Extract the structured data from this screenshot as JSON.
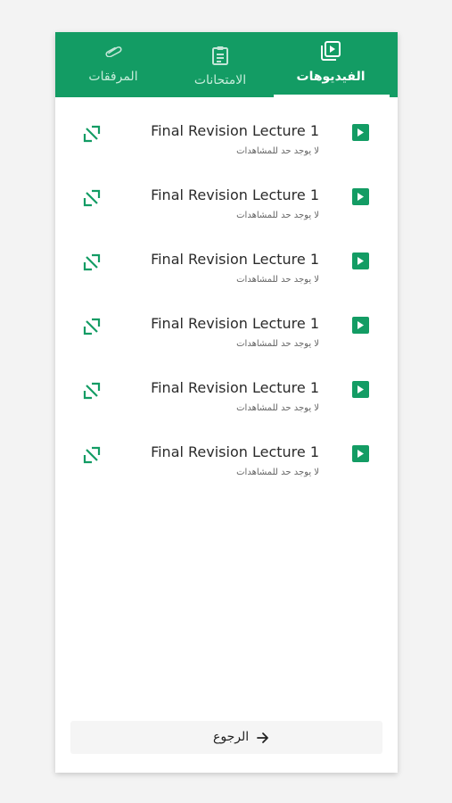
{
  "tabs": [
    {
      "label": "الفيديوهات",
      "icon": "video-library-icon",
      "active": true
    },
    {
      "label": "الامتحانات",
      "icon": "clipboard-icon",
      "active": false
    },
    {
      "label": "المرفقات",
      "icon": "paperclip-icon",
      "active": false
    }
  ],
  "videos": [
    {
      "title": "Final Revision Lecture 1",
      "subtitle": "لا يوجد حد للمشاهدات"
    },
    {
      "title": "Final Revision Lecture 1",
      "subtitle": "لا يوجد حد للمشاهدات"
    },
    {
      "title": "Final Revision Lecture 1",
      "subtitle": "لا يوجد حد للمشاهدات"
    },
    {
      "title": "Final Revision Lecture 1",
      "subtitle": "لا يوجد حد للمشاهدات"
    },
    {
      "title": "Final Revision Lecture 1",
      "subtitle": "لا يوجد حد للمشاهدات"
    },
    {
      "title": "Final Revision Lecture 1",
      "subtitle": "لا يوجد حد للمشاهدات"
    }
  ],
  "footer": {
    "back_label": "الرجوع",
    "back_icon": "arrow-right-icon"
  },
  "colors": {
    "accent": "#139c64",
    "background": "#f3f3f3",
    "card": "#ffffff"
  }
}
